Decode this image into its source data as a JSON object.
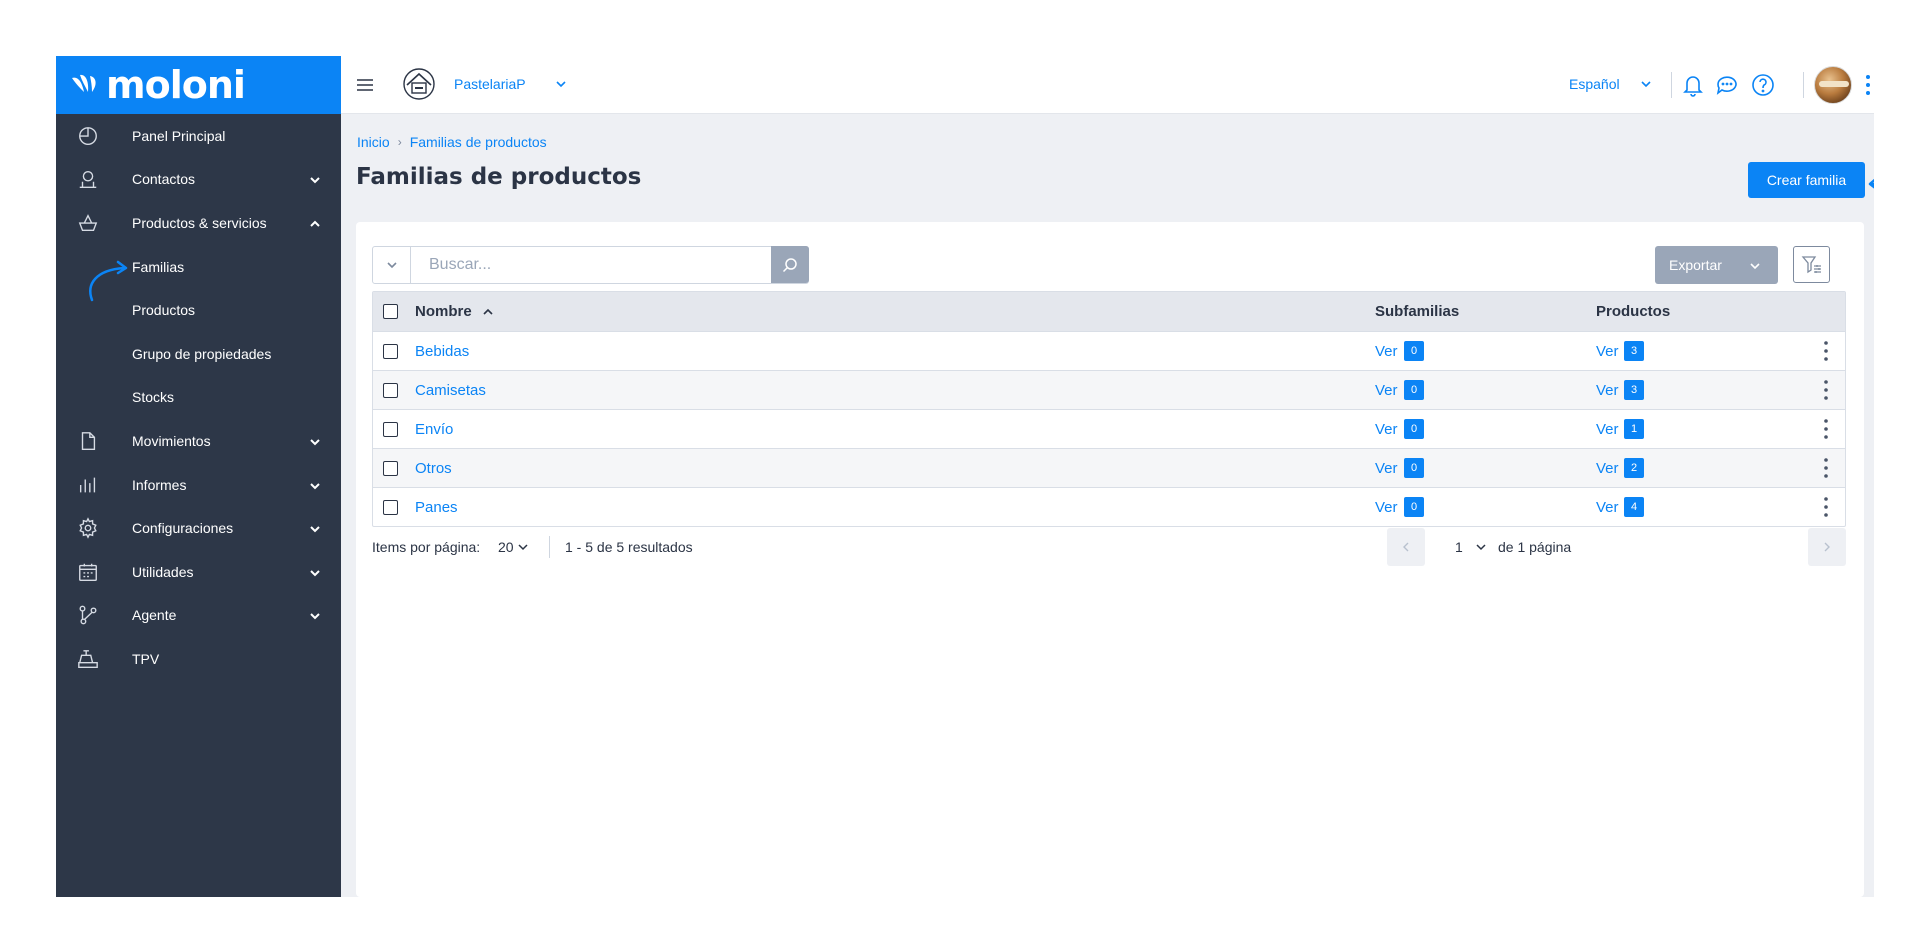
{
  "app": {
    "logo": "moloni"
  },
  "sidebar": {
    "items": [
      {
        "label": "Panel Principal",
        "icon": "dashboard-icon"
      },
      {
        "label": "Contactos",
        "icon": "contacts-icon",
        "chevron": "down"
      },
      {
        "label": "Productos & servicios",
        "icon": "basket-icon",
        "chevron": "up"
      },
      {
        "label": "Familias"
      },
      {
        "label": "Productos"
      },
      {
        "label": "Grupo de propiedades"
      },
      {
        "label": "Stocks"
      },
      {
        "label": "Movimientos",
        "icon": "document-icon",
        "chevron": "down"
      },
      {
        "label": "Informes",
        "icon": "bars-icon",
        "chevron": "down"
      },
      {
        "label": "Configuraciones",
        "icon": "gear-icon",
        "chevron": "down"
      },
      {
        "label": "Utilidades",
        "icon": "calendar-icon",
        "chevron": "down"
      },
      {
        "label": "Agente",
        "icon": "network-icon",
        "chevron": "down"
      },
      {
        "label": "TPV",
        "icon": "cash-register-icon"
      }
    ]
  },
  "topbar": {
    "company_name": "PastelariaP",
    "language": "Español"
  },
  "breadcrumb": {
    "home": "Inicio",
    "separator": "›",
    "current": "Familias de productos"
  },
  "page": {
    "title": "Familias de productos",
    "create_button": "Crear familia"
  },
  "toolbar": {
    "search_placeholder": "Buscar...",
    "export_label": "Exportar"
  },
  "table": {
    "headers": {
      "name": "Nombre",
      "subfamilies": "Subfamilias",
      "products": "Productos"
    },
    "rows": [
      {
        "name": "Bebidas",
        "sub_link": "Ver",
        "sub_count": "0",
        "prod_link": "Ver",
        "prod_count": "3"
      },
      {
        "name": "Camisetas",
        "sub_link": "Ver",
        "sub_count": "0",
        "prod_link": "Ver",
        "prod_count": "3"
      },
      {
        "name": "Envío",
        "sub_link": "Ver",
        "sub_count": "0",
        "prod_link": "Ver",
        "prod_count": "1"
      },
      {
        "name": "Otros",
        "sub_link": "Ver",
        "sub_count": "0",
        "prod_link": "Ver",
        "prod_count": "2"
      },
      {
        "name": "Panes",
        "sub_link": "Ver",
        "sub_count": "0",
        "prod_link": "Ver",
        "prod_count": "4"
      }
    ]
  },
  "pagination": {
    "items_label": "Items por página:",
    "items_value": "20",
    "results": "1 - 5 de 5 resultados",
    "page": "1",
    "of_pages": "de 1 página"
  },
  "colors": {
    "brand": "#0b84f5",
    "sidebar": "#2d3748",
    "muted_button": "#9aa6b8"
  }
}
